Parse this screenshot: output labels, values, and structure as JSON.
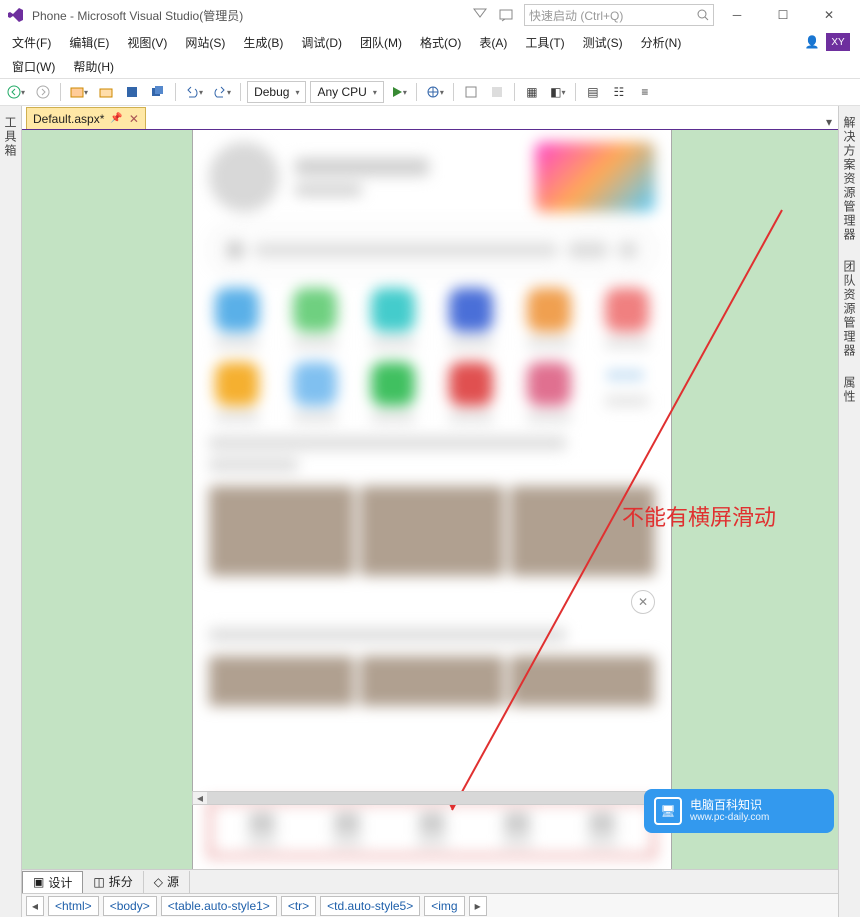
{
  "titlebar": {
    "title": "Phone - Microsoft Visual Studio(管理员)",
    "quick_launch_placeholder": "快速启动 (Ctrl+Q)"
  },
  "menubar": {
    "items": [
      {
        "label": "文件(F)"
      },
      {
        "label": "编辑(E)"
      },
      {
        "label": "视图(V)"
      },
      {
        "label": "网站(S)"
      },
      {
        "label": "生成(B)"
      },
      {
        "label": "调试(D)"
      },
      {
        "label": "团队(M)"
      },
      {
        "label": "格式(O)"
      },
      {
        "label": "表(A)"
      },
      {
        "label": "工具(T)"
      },
      {
        "label": "测试(S)"
      },
      {
        "label": "分析(N)"
      },
      {
        "label": "窗口(W)"
      },
      {
        "label": "帮助(H)"
      }
    ],
    "user_badge": "XY"
  },
  "toolbar": {
    "config_label": "Debug",
    "platform_label": "Any CPU"
  },
  "side_left": {
    "label": "工具箱"
  },
  "side_right": {
    "groups": [
      {
        "label": "解决方案资源管理器"
      },
      {
        "label": "团队资源管理器"
      },
      {
        "label": "属性"
      }
    ]
  },
  "tabs": {
    "active": {
      "label": "Default.aspx*"
    }
  },
  "design_tabs": {
    "items": [
      {
        "label": "设计",
        "active": true
      },
      {
        "label": "拆分"
      },
      {
        "label": "源"
      }
    ]
  },
  "breadcrumb": {
    "items": [
      {
        "label": "<html>"
      },
      {
        "label": "<body>"
      },
      {
        "label": "<table.auto-style1>"
      },
      {
        "label": "<tr>"
      },
      {
        "label": "<td.auto-style5>"
      },
      {
        "label": "<img"
      }
    ]
  },
  "annotation": {
    "text": "不能有横屏滑动"
  },
  "watermark": {
    "title": "电脑百科知识",
    "url": "www.pc-daily.com"
  },
  "icon_colors": {
    "row1": [
      "c-blue",
      "c-green",
      "c-cyan",
      "c-navy",
      "c-orange",
      "c-pink"
    ],
    "row2": [
      "c-amber",
      "c-sky",
      "c-emerald",
      "c-red",
      "c-rose"
    ]
  }
}
